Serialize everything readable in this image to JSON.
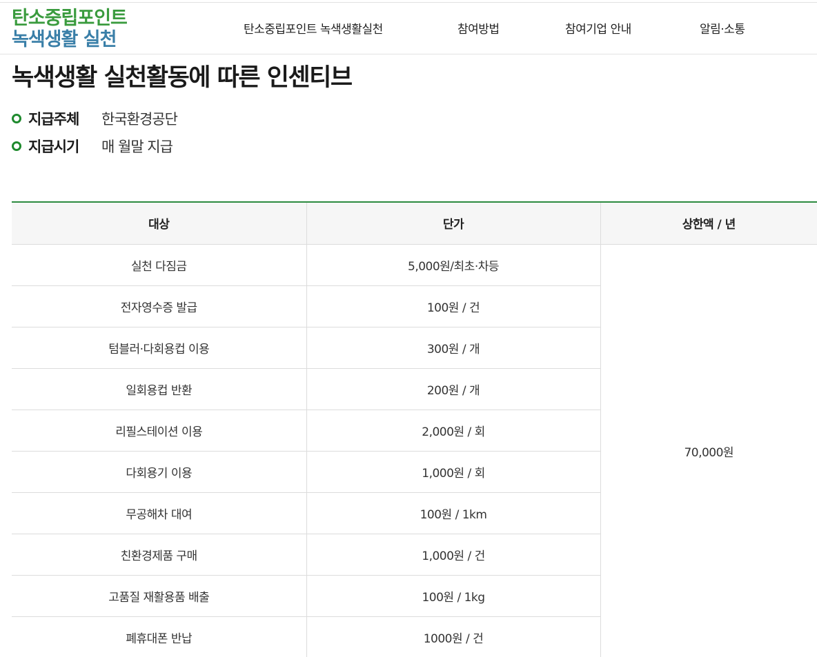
{
  "header": {
    "logo": {
      "line1": "탄소중립포인트",
      "line2": "녹색생활 실천",
      "line1_color": "#3a9b3e",
      "line2_color": "#3a7fa8"
    },
    "nav": [
      {
        "label": "탄소중립포인트 녹색생활실천"
      },
      {
        "label": "참여방법"
      },
      {
        "label": "참여기업 안내"
      },
      {
        "label": "알림·소통"
      }
    ]
  },
  "main": {
    "title": "녹색생활 실천활동에 따른 인센티브",
    "info": [
      {
        "key": "지급주체",
        "value": "한국환경공단"
      },
      {
        "key": "지급시기",
        "value": "매 월말 지급"
      }
    ],
    "table": {
      "headers": [
        "대상",
        "단가",
        "상한액 / 년"
      ],
      "rows": [
        {
          "target": "실천 다짐금",
          "price": "5,000원/최초·차등"
        },
        {
          "target": "전자영수증 발급",
          "price": "100원 / 건"
        },
        {
          "target": "텀블러·다회용컵 이용",
          "price": "300원 / 개"
        },
        {
          "target": "일회용컵 반환",
          "price": "200원 / 개"
        },
        {
          "target": "리필스테이션 이용",
          "price": "2,000원 / 회"
        },
        {
          "target": "다회용기 이용",
          "price": "1,000원 / 회"
        },
        {
          "target": "무공해차 대여",
          "price": "100원 / 1km"
        },
        {
          "target": "친환경제품 구매",
          "price": "1,000원 / 건"
        },
        {
          "target": "고품질 재활용품 배출",
          "price": "100원 / 1kg"
        },
        {
          "target": "폐휴대폰 반납",
          "price": "1000원 / 건"
        }
      ],
      "limit": "70,000원"
    },
    "accent_color": "#2b8a3e"
  }
}
